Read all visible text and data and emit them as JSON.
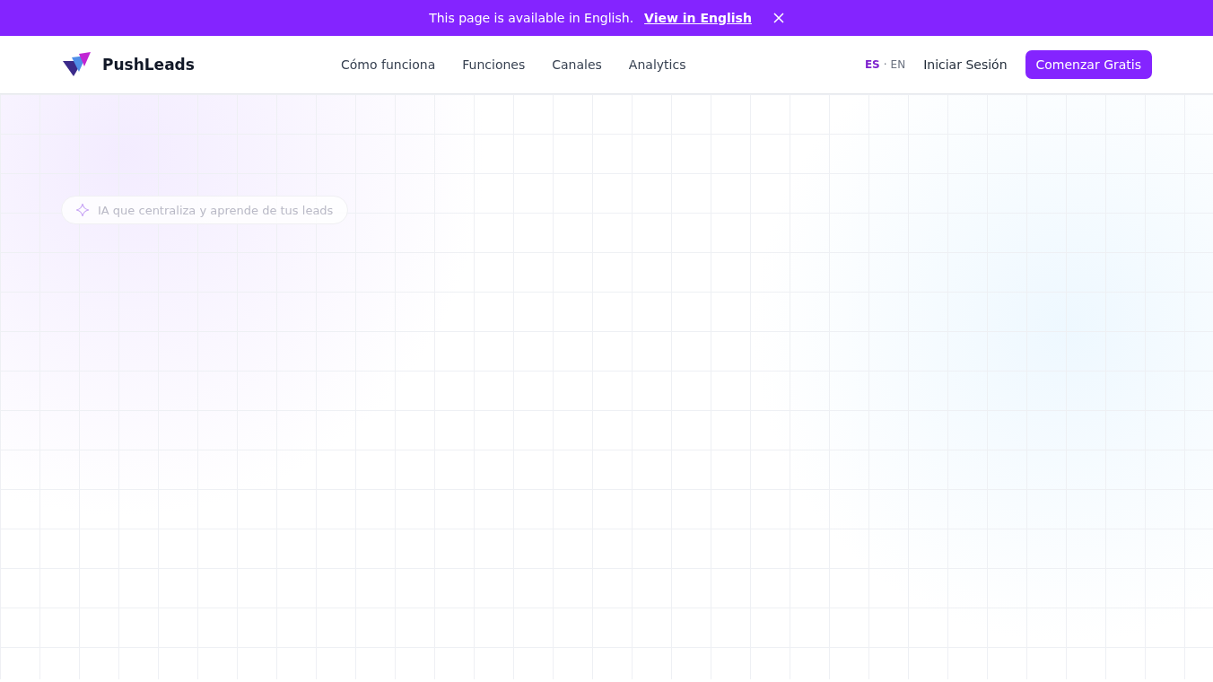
{
  "banner": {
    "message": "This page is available in English.",
    "link": "View in English"
  },
  "header": {
    "brand": "PushLeads",
    "nav": [
      {
        "label": "Cómo funciona"
      },
      {
        "label": "Funciones"
      },
      {
        "label": "Canales"
      },
      {
        "label": "Analytics"
      }
    ],
    "languages": [
      {
        "label": "ES",
        "selected": true
      },
      {
        "label": "EN",
        "selected": false
      }
    ],
    "separator": "·",
    "login": "Iniciar Sesión",
    "cta": "Comenzar Gratis"
  },
  "hero": {
    "badge": "IA que centraliza y aprende de tus leads"
  }
}
